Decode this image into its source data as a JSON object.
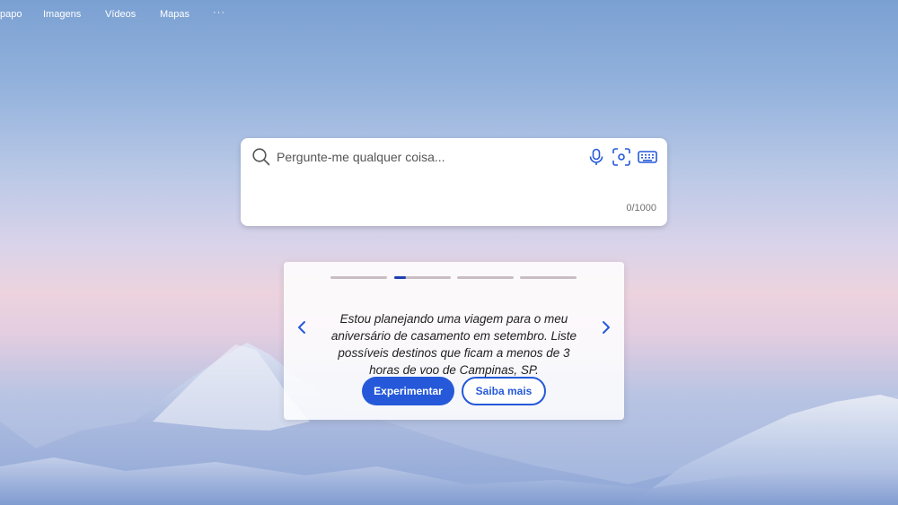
{
  "nav": {
    "items": [
      "papo",
      "Imagens",
      "Vídeos",
      "Mapas"
    ],
    "more": "···"
  },
  "search": {
    "placeholder": "Pergunte-me qualquer coisa...",
    "counter": "0/1000",
    "icons": [
      "search-icon",
      "microphone-icon",
      "visual-search-icon",
      "keyboard-icon"
    ]
  },
  "suggestion": {
    "text": "Estou planejando uma viagem para o meu aniversário de casamento em setembro. Liste possíveis destinos que ficam a menos de 3 horas de voo de Campinas, SP.",
    "try_label": "Experimentar",
    "learn_label": "Saiba mais",
    "active_indicator": 2,
    "indicator_count": 4,
    "active_progress": 0.2
  },
  "colors": {
    "accent": "#2559d9",
    "indicator_active": "#1e40af",
    "indicator_inactive": "#c9bcc4"
  }
}
